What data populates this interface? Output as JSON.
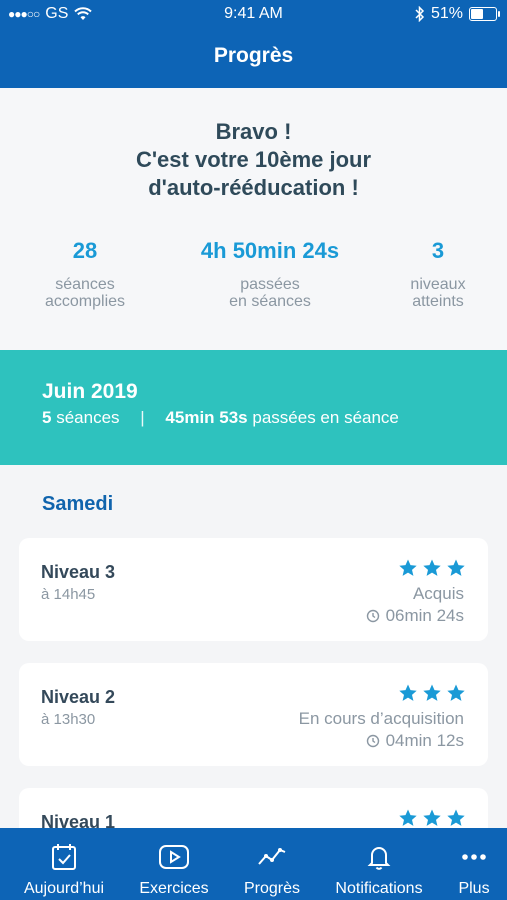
{
  "status_bar": {
    "carrier": "GS",
    "time": "9:41 AM",
    "battery": "51%"
  },
  "header": {
    "title": "Progrès"
  },
  "summary": {
    "congrats_line1": "Bravo !",
    "congrats_line2": "C'est votre 10ème jour",
    "congrats_line3": "d'auto-rééducation !",
    "stats": [
      {
        "value": "28",
        "label_line1": "séances",
        "label_line2": "accomplies"
      },
      {
        "value": "4h 50min 24s",
        "label_line1": "passées",
        "label_line2": "en séances"
      },
      {
        "value": "3",
        "label_line1": "niveaux",
        "label_line2": "atteints"
      }
    ]
  },
  "month": {
    "name": "Juin 2019",
    "sessions_count": "5",
    "sessions_label": "séances",
    "separator": "|",
    "time_spent": "45min 53s",
    "time_label": "passées en séance"
  },
  "day": {
    "label": "Samedi",
    "sessions": [
      {
        "level": "Niveau 3",
        "time": "à 14h45",
        "status": "Acquis",
        "duration": "06min 24s",
        "stars": 3
      },
      {
        "level": "Niveau 2",
        "time": "à 13h30",
        "status": "En cours d’acquisition",
        "duration": "04min 12s",
        "stars": 3
      },
      {
        "level": "Niveau 1",
        "time": "",
        "status": "",
        "duration": "",
        "stars": 3
      }
    ]
  },
  "tabbar": {
    "tabs": [
      {
        "label": "Aujourd’hui",
        "icon": "calendar-check-icon"
      },
      {
        "label": "Exercices",
        "icon": "play-icon"
      },
      {
        "label": "Progrès",
        "icon": "chart-line-icon"
      },
      {
        "label": "Notifications",
        "icon": "bell-icon"
      },
      {
        "label": "Plus",
        "icon": "more-icon"
      }
    ]
  },
  "colors": {
    "primary": "#0d64b6",
    "accent": "#1a9ad6",
    "teal": "#2ec2be",
    "star": "#1a9ad6"
  }
}
